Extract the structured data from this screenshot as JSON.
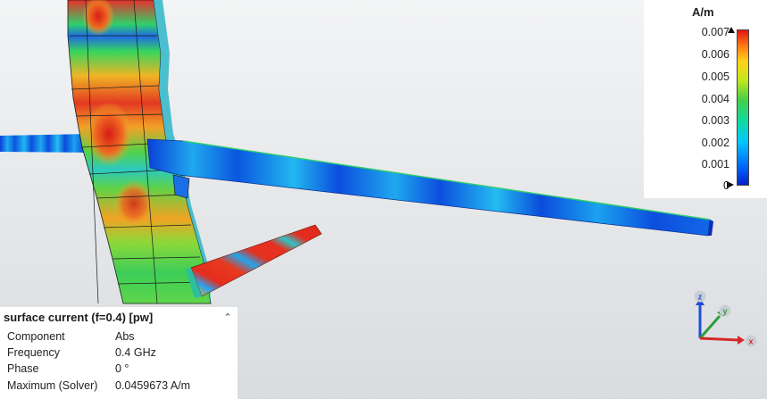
{
  "colorbar": {
    "unit": "A/m",
    "ticks": [
      "0.007",
      "0.006",
      "0.005",
      "0.004",
      "0.003",
      "0.002",
      "0.001",
      "0"
    ],
    "max_arrow": "up-arrow-icon",
    "min_arrow": "right-arrow-icon"
  },
  "info_panel": {
    "title": "surface current (f=0.4) [pw]",
    "collapse_icon": "chevron-up-icon",
    "rows": [
      {
        "key": "Component",
        "value": "Abs"
      },
      {
        "key": "Frequency",
        "value": "0.4 GHz"
      },
      {
        "key": "Phase",
        "value": "0 °"
      },
      {
        "key": "Maximum (Solver)",
        "value": "0.0459673 A/m"
      }
    ]
  },
  "axes_triad": {
    "x_label": "x",
    "y_label": "y",
    "z_label": "z",
    "x_color": "#d62828",
    "y_color": "#2e9e3a",
    "z_color": "#1f4fd6"
  }
}
